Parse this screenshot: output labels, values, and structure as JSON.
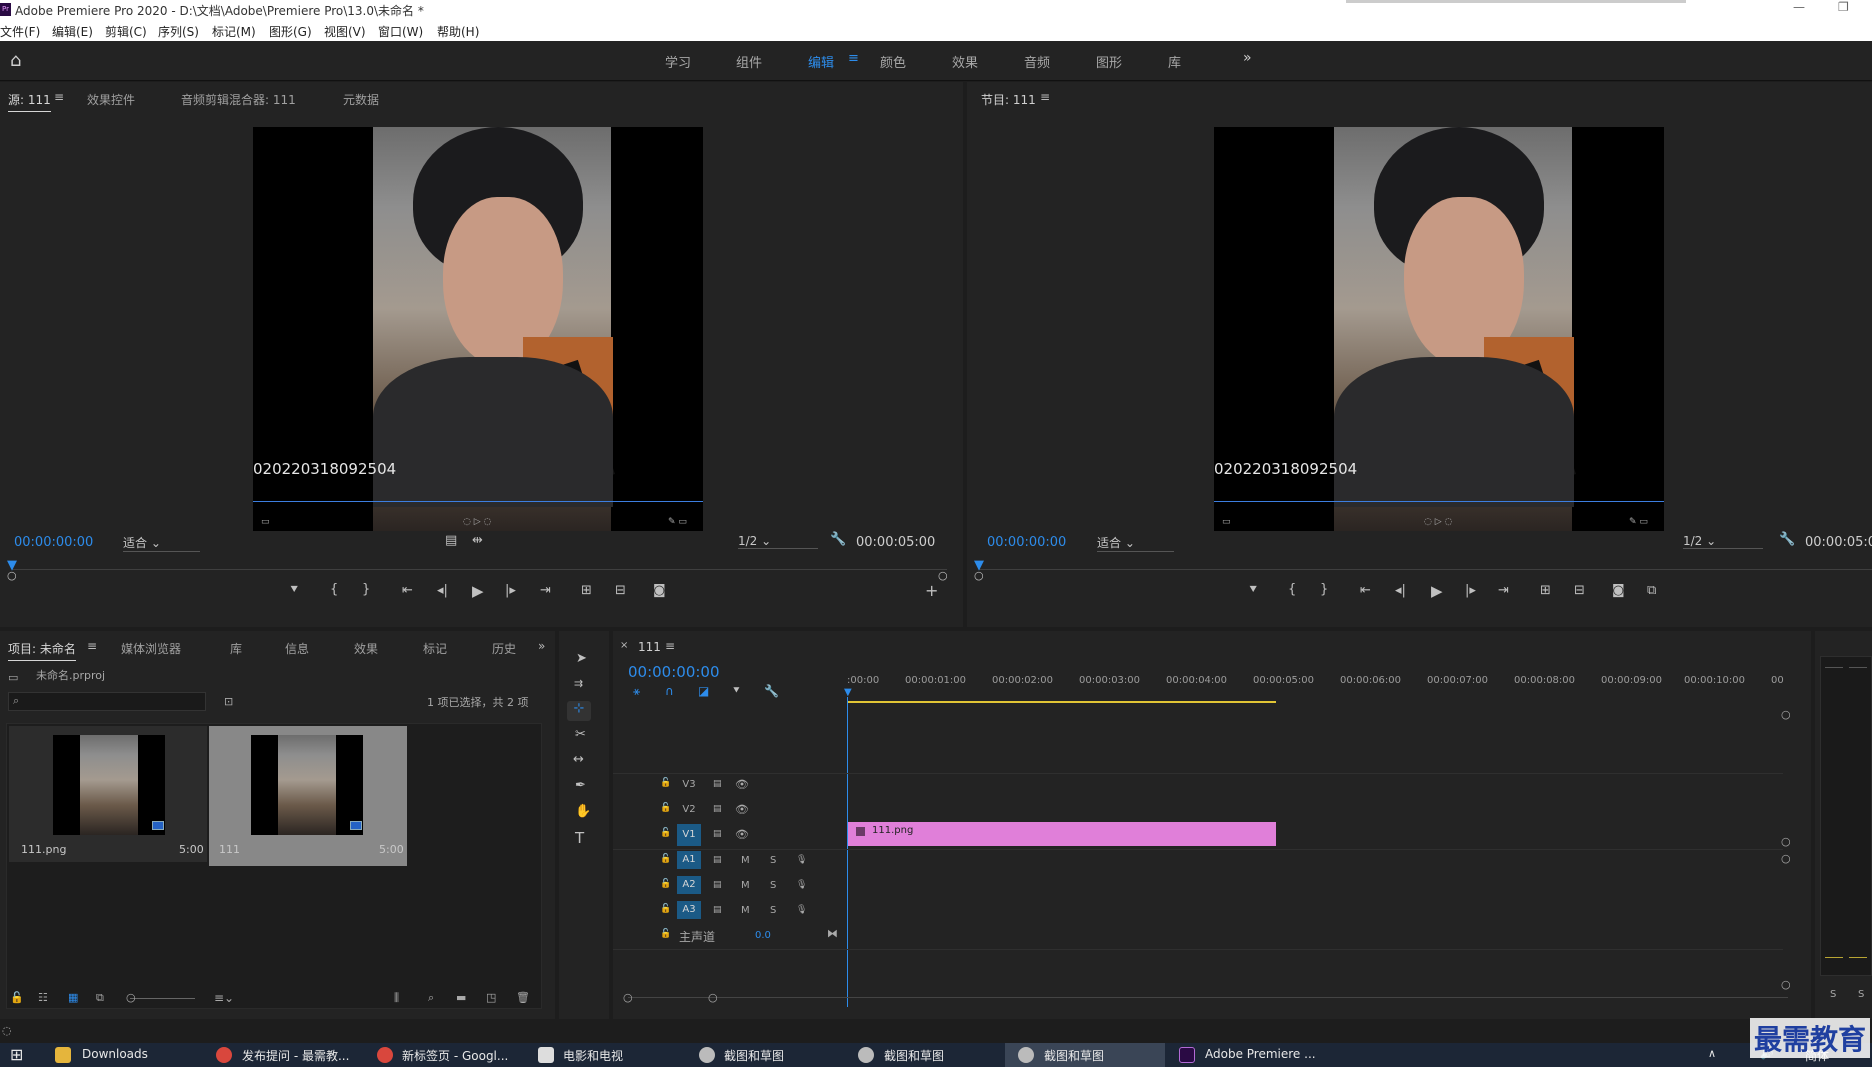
{
  "titlebar": {
    "title": "Adobe Premiere Pro 2020 - D:\\文档\\Adobe\\Premiere Pro\\13.0\\未命名 *"
  },
  "menu": [
    "文件(F)",
    "编辑(E)",
    "剪辑(C)",
    "序列(S)",
    "标记(M)",
    "图形(G)",
    "视图(V)",
    "窗口(W)",
    "帮助(H)"
  ],
  "workspaces": [
    "学习",
    "组件",
    "编辑",
    "颜色",
    "效果",
    "音频",
    "图形",
    "库"
  ],
  "workspace_active": "编辑",
  "source": {
    "tabs": [
      "源: 111",
      "效果控件",
      "音频剪辑混合器: 111",
      "元数据"
    ],
    "overlay_timecode": "020220318092504",
    "timecode": "00:00:00:00",
    "fit": "适合",
    "resolution": "1/2",
    "duration": "00:00:05:00"
  },
  "program": {
    "tab": "节目: 111",
    "overlay_timecode": "020220318092504",
    "timecode": "00:00:00:00",
    "fit": "适合",
    "resolution": "1/2",
    "duration": "00:00:05:0"
  },
  "project": {
    "tabs": [
      "项目: 未命名",
      "媒体浏览器",
      "库",
      "信息",
      "效果",
      "标记",
      "历史"
    ],
    "file": "未命名.prproj",
    "selection_info": "1 项已选择，共 2 项",
    "items": [
      {
        "name": "111.png",
        "duration": "5:00"
      },
      {
        "name": "111",
        "duration": "5:00"
      }
    ]
  },
  "timeline": {
    "tab": "111",
    "timecode": "00:00:00:00",
    "ruler": [
      ":00:00",
      "00:00:01:00",
      "00:00:02:00",
      "00:00:03:00",
      "00:00:04:00",
      "00:00:05:00",
      "00:00:06:00",
      "00:00:07:00",
      "00:00:08:00",
      "00:00:09:00",
      "00:00:10:00",
      "00"
    ],
    "video_tracks": [
      "V3",
      "V2",
      "V1"
    ],
    "audio_tracks": [
      "A1",
      "A2",
      "A3"
    ],
    "track_m": "M",
    "track_s": "S",
    "master_label": "主声道",
    "master_value": "0.0",
    "clip_name": "111.png"
  },
  "taskbar": {
    "items": [
      "Downloads",
      "发布提问 - 最需教...",
      "新标签页 - Googl...",
      "电影和电视",
      "截图和草图",
      "截图和草图",
      "截图和草图",
      "Adobe Premiere ..."
    ],
    "lang": "简体"
  },
  "watermark": "最需教育",
  "colors": {
    "accent": "#2d8ceb",
    "clip": "#e07fd9",
    "track_active": "#1b5a86",
    "background": "#232323"
  }
}
